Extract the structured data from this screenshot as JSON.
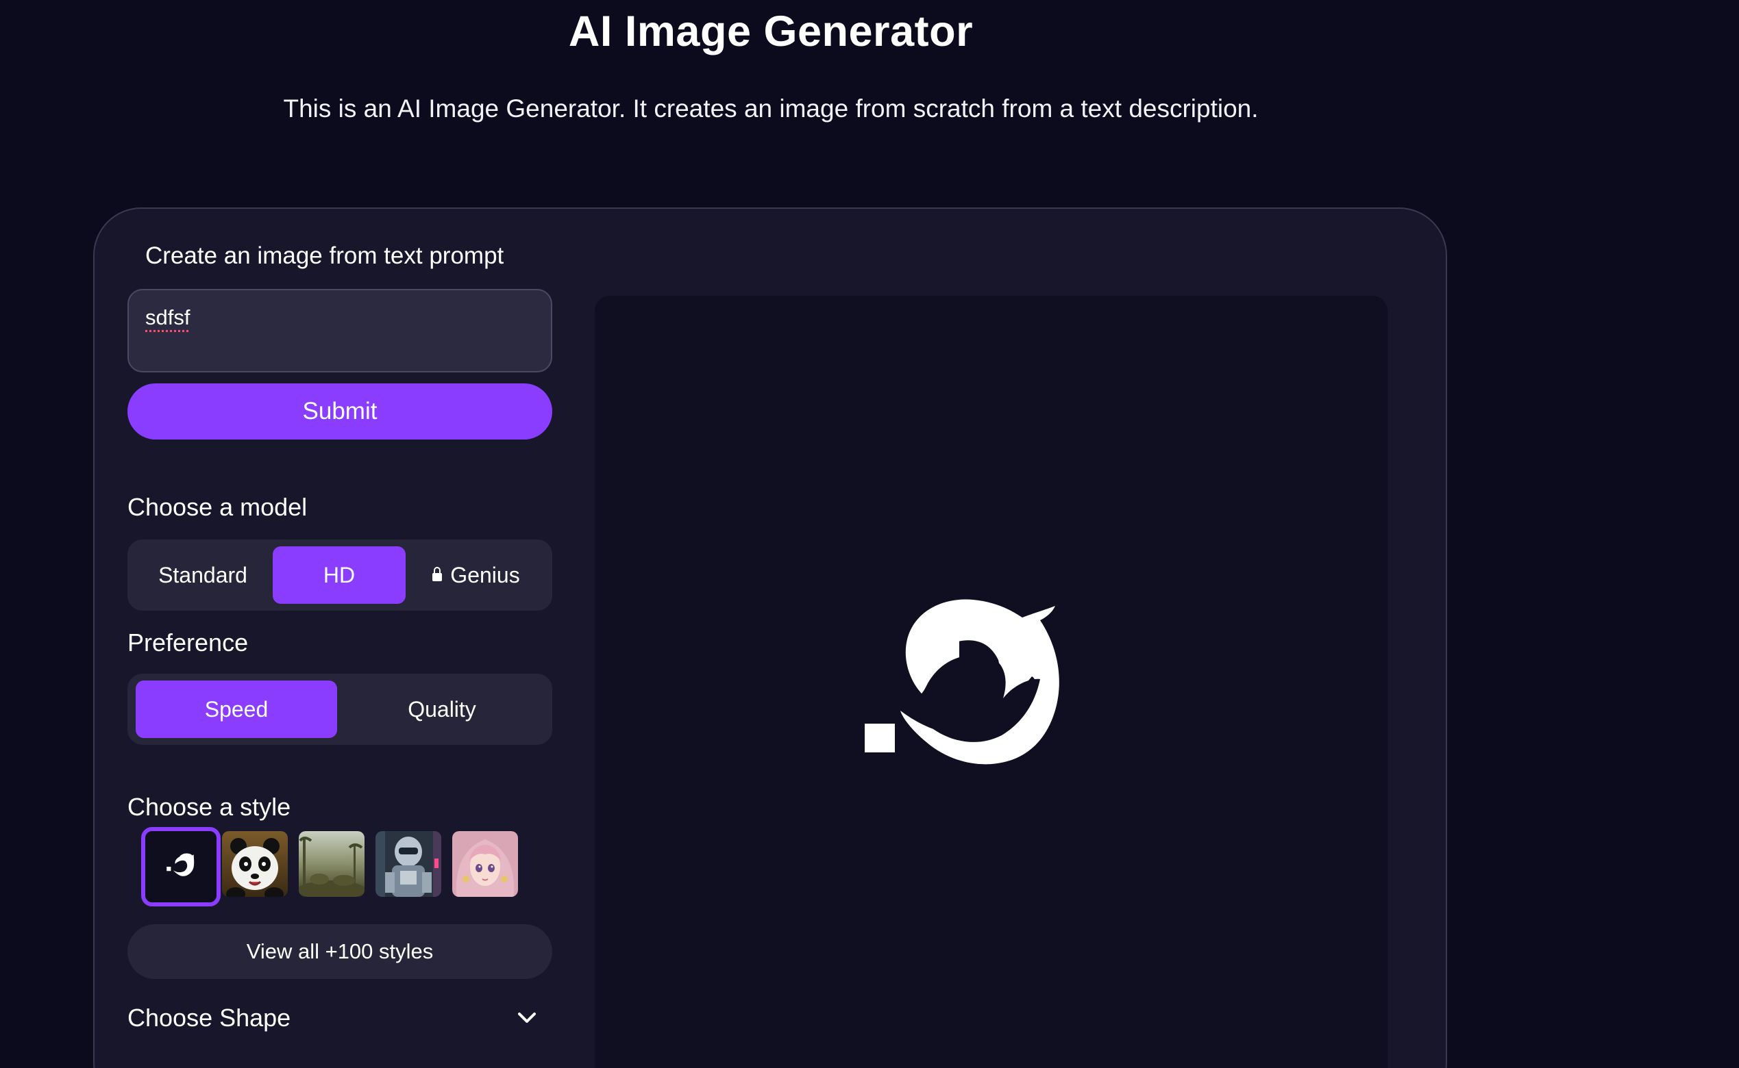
{
  "header": {
    "title": "AI Image Generator",
    "subtitle": "This is an AI Image Generator. It creates an image from scratch from a text description."
  },
  "prompt": {
    "label": "Create an image from text prompt",
    "value": "sdfsf",
    "submit_label": "Submit"
  },
  "model": {
    "label": "Choose a model",
    "options": [
      "Standard",
      "HD",
      "Genius"
    ],
    "selected": "HD",
    "locked": [
      "Genius"
    ]
  },
  "preference": {
    "label": "Preference",
    "options": [
      "Speed",
      "Quality"
    ],
    "selected": "Speed"
  },
  "style": {
    "label": "Choose a style",
    "thumbnails": [
      {
        "icon": "dolphin-logo-icon",
        "selected": true
      },
      {
        "icon": "panda-thumbnail",
        "selected": false
      },
      {
        "icon": "landscape-thumbnail",
        "selected": false
      },
      {
        "icon": "robot-thumbnail",
        "selected": false
      },
      {
        "icon": "anime-girl-thumbnail",
        "selected": false
      }
    ],
    "view_all_label": "View all +100 styles"
  },
  "shape": {
    "label": "Choose Shape",
    "icon": "chevron-down-icon"
  },
  "preview": {
    "icon": "dolphin-logo-icon"
  },
  "colors": {
    "background": "#0c0b1d",
    "panel": "#17162a",
    "accent": "#8b3dff",
    "control_bg": "#26253a"
  }
}
